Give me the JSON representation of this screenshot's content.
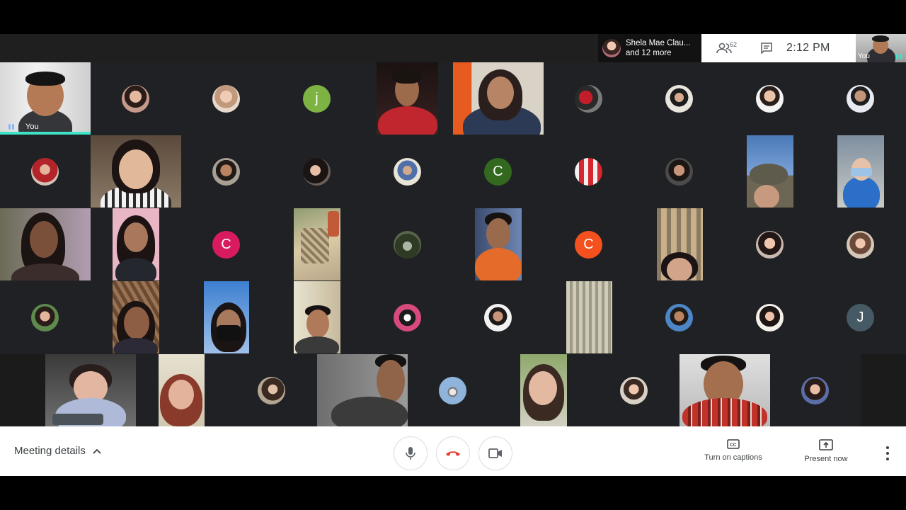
{
  "header": {
    "presenter_name": "Shela Mae Clau...",
    "presenter_more": "and 12 more",
    "people_count": "62",
    "time": "2:12  PM",
    "self_label": "You"
  },
  "self_tile": {
    "label": "You"
  },
  "letter_avatars": {
    "j_lower": "j",
    "c_row2": "C",
    "c_row3_left": "C",
    "c_row3_right": "C",
    "j_upper": "J"
  },
  "controls": {
    "meeting_details_label": "Meeting details",
    "captions_label": "Turn on captions",
    "present_label": "Present now"
  },
  "colors": {
    "grid_background": "#202124",
    "speaking_indicator": "#3ee4c7",
    "hangup_red": "#ea4335",
    "letter_j_lower": "#7cb342",
    "letter_c_row2": "#33691e",
    "letter_c_row3_left": "#d81b60",
    "letter_c_row3_right": "#f4511e",
    "letter_j_upper": "#455a64"
  }
}
